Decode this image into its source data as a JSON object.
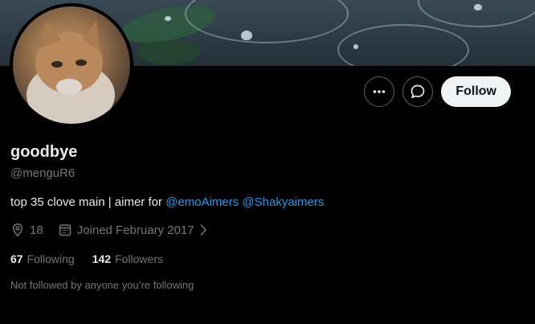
{
  "profile": {
    "display_name": "goodbye",
    "handle": "@menguR6",
    "bio_text": "top 35 clove main | aimer for ",
    "bio_mentions": [
      "@emoAimers",
      "@Shakyaimers"
    ],
    "location": "18",
    "joined": "Joined February 2017",
    "following_count": "67",
    "following_label": "Following",
    "followers_count": "142",
    "followers_label": "Followers",
    "not_followed_text": "Not followed by anyone you’re following"
  },
  "actions": {
    "more_icon": "more-icon",
    "message_icon": "message-icon",
    "follow_label": "Follow"
  },
  "colors": {
    "background": "#000000",
    "text_primary": "#e7e9ea",
    "text_secondary": "#71767b",
    "accent": "#1d9bf0",
    "button_bg": "#eff3f4"
  }
}
